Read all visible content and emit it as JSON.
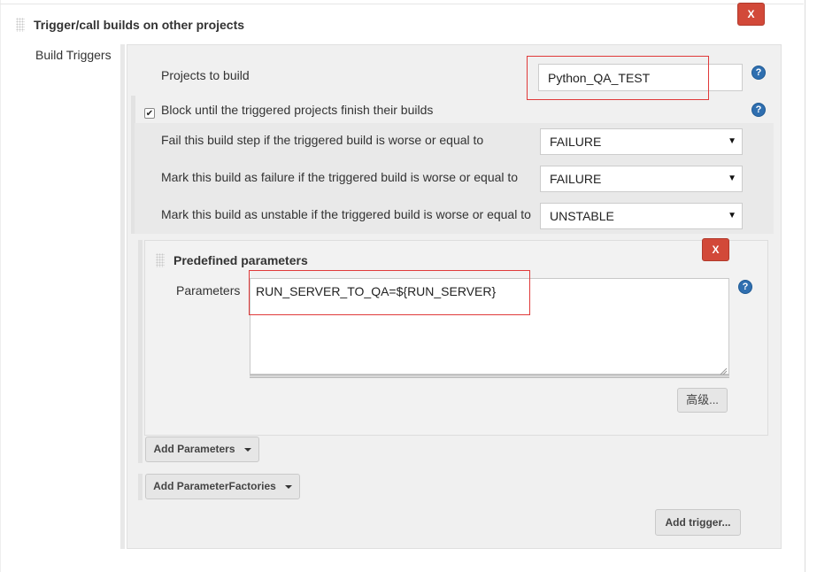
{
  "section": {
    "title": "Trigger/call builds on other projects",
    "side_label": "Build Triggers",
    "delete_label": "X"
  },
  "projects": {
    "label": "Projects to build",
    "value": "Python_QA_TEST",
    "help": "?"
  },
  "block": {
    "checked": true,
    "checkmark": "✔",
    "label": "Block until the triggered projects finish their builds",
    "help": "?",
    "rows": [
      {
        "label": "Fail this build step if the triggered build is worse or equal to",
        "value": "FAILURE"
      },
      {
        "label": "Mark this build as failure if the triggered build is worse or equal to",
        "value": "FAILURE"
      },
      {
        "label": "Mark this build as unstable if the triggered build is worse or equal to",
        "value": "UNSTABLE"
      }
    ],
    "dropdown_arrow": "▼"
  },
  "predefined": {
    "title": "Predefined parameters",
    "delete_label": "X",
    "params_label": "Parameters",
    "params_value": "RUN_SERVER_TO_QA=${RUN_SERVER}",
    "help": "?",
    "advanced_label": "高级..."
  },
  "buttons": {
    "add_parameters": "Add Parameters",
    "add_parameter_factories": "Add ParameterFactories",
    "add_trigger": "Add trigger..."
  },
  "colors": {
    "delete_red": "#d24939",
    "highlight_red": "#e03a3a",
    "help_blue": "#2f6fb0"
  }
}
